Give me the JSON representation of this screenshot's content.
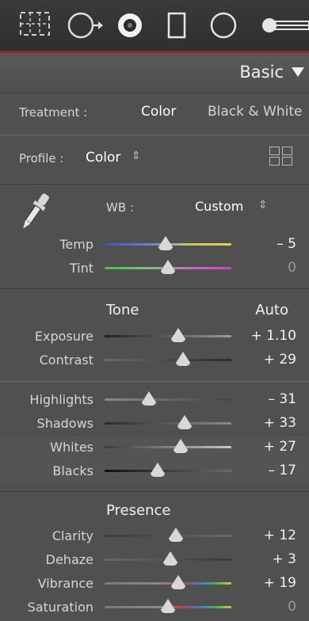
{
  "toolbar": {
    "tools": [
      {
        "icon": "crop-overlay-icon"
      },
      {
        "icon": "spot-removal-icon"
      },
      {
        "icon": "red-eye-icon"
      },
      {
        "icon": "graduated-filter-icon"
      },
      {
        "icon": "radial-filter-icon"
      },
      {
        "icon": "adjustment-brush-icon"
      }
    ]
  },
  "panel": {
    "title": "Basic",
    "treatment": {
      "label": "Treatment :",
      "options": [
        "Color",
        "Black & White"
      ],
      "selected": "Color"
    },
    "profile": {
      "label": "Profile :",
      "value": "Color",
      "grid_icon": "profile-browser-icon"
    },
    "wb": {
      "label": "WB :",
      "value": "Custom",
      "dropper_icon": "eyedropper-icon"
    },
    "sliders_wb": [
      {
        "label": "Temp",
        "value": "– 5",
        "position": 0.48,
        "track": "temp"
      },
      {
        "label": "Tint",
        "value": "0",
        "position": 0.5,
        "track": "tint",
        "dim": true
      }
    ],
    "tone": {
      "heading": "Tone",
      "auto_label": "Auto",
      "sliders": [
        {
          "label": "Exposure",
          "value": "+ 1.10",
          "position": 0.58
        },
        {
          "label": "Contrast",
          "value": "+ 29",
          "position": 0.62
        }
      ]
    },
    "tone2": {
      "sliders": [
        {
          "label": "Highlights",
          "value": "– 31",
          "position": 0.35
        },
        {
          "label": "Shadows",
          "value": "+ 33",
          "position": 0.63
        },
        {
          "label": "Whites",
          "value": "+ 27",
          "position": 0.6
        },
        {
          "label": "Blacks",
          "value": "– 17",
          "position": 0.42
        }
      ]
    },
    "presence": {
      "heading": "Presence",
      "sliders": [
        {
          "label": "Clarity",
          "value": "+ 12",
          "position": 0.56,
          "track": "gray"
        },
        {
          "label": "Dehaze",
          "value": "+ 3",
          "position": 0.52,
          "track": "gray"
        },
        {
          "label": "Vibrance",
          "value": "+ 19",
          "position": 0.58,
          "track": "vibrance"
        },
        {
          "label": "Saturation",
          "value": "0",
          "position": 0.5,
          "track": "saturation",
          "dim": true
        }
      ]
    }
  },
  "colors": {
    "toolbar_accent": "#8a2a2f",
    "panel_bg": "#505050"
  }
}
